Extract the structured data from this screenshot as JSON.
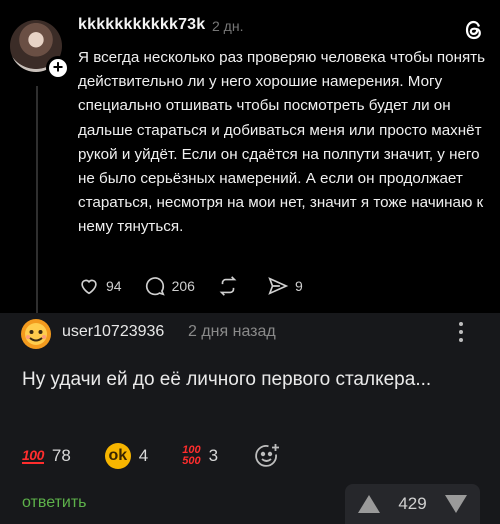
{
  "post": {
    "username": "kkkkkkkkkkk73k",
    "time": "2 дн.",
    "text": "Я всегда несколько раз проверяю человека чтобы понять действительно ли у него хорошие намерения. Могу специально отшивать чтобы посмотреть будет ли он дальше стараться и добиваться меня или просто махнёт рукой и уйдёт. Если он сдаётся на полпути значит, у него не было серьёзных намерений. А если он продолжает стараться, несмотря на мои нет, значит я тоже начинаю к нему тянуться.",
    "likes": "94",
    "replies": "206",
    "shares": "9",
    "icons": [
      "plus-icon",
      "threads-logo-icon",
      "heart-icon",
      "comment-icon",
      "repost-icon",
      "share-icon"
    ]
  },
  "comment": {
    "username": "user10723936",
    "time": "2 дня назад",
    "text": "Ну удачи ей до её личного первого сталкера...",
    "reactions": [
      {
        "emoji": "100-emoji",
        "count": "78"
      },
      {
        "emoji": "ok-hand-emoji",
        "count": "4"
      },
      {
        "emoji": "100-500-emoji",
        "count": "3"
      }
    ],
    "reply_label": "ответить",
    "rating": "429",
    "colors": {
      "reply": "#5db14a",
      "emoji_red": "#ff2d2d",
      "background": "#17181b"
    }
  }
}
